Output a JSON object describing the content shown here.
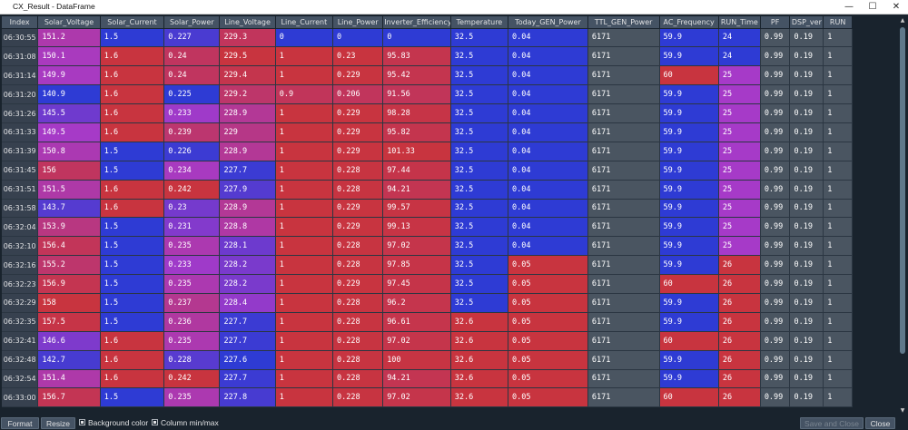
{
  "window": {
    "title": "CX_Result - DataFrame",
    "min_icon": "minimize-icon",
    "max_icon": "maximize-icon",
    "close_icon": "close-icon"
  },
  "columns": [
    "Index",
    "Solar_Voltage",
    "Solar_Current",
    "Solar_Power",
    "Line_Voltage",
    "Line_Current",
    "Line_Power",
    "Inverter_Efficiency",
    "Temperature",
    "Today_GEN_Power",
    "TTL_GEN_Power",
    "AC_Frequency",
    "RUN_Time",
    "PF",
    "DSP_ver",
    "RUN"
  ],
  "rows": [
    [
      "06:30:55",
      "151.2",
      "1.5",
      "0.227",
      "229.3",
      "0",
      "0",
      "0",
      "32.5",
      "0.04",
      "6171",
      "59.9",
      "24",
      "0.99",
      "0.19",
      "1"
    ],
    [
      "06:31:08",
      "150.1",
      "1.6",
      "0.24",
      "229.5",
      "1",
      "0.23",
      "95.83",
      "32.5",
      "0.04",
      "6171",
      "59.9",
      "24",
      "0.99",
      "0.19",
      "1"
    ],
    [
      "06:31:14",
      "149.9",
      "1.6",
      "0.24",
      "229.4",
      "1",
      "0.229",
      "95.42",
      "32.5",
      "0.04",
      "6171",
      "60",
      "25",
      "0.99",
      "0.19",
      "1"
    ],
    [
      "06:31:20",
      "140.9",
      "1.6",
      "0.225",
      "229.2",
      "0.9",
      "0.206",
      "91.56",
      "32.5",
      "0.04",
      "6171",
      "59.9",
      "25",
      "0.99",
      "0.19",
      "1"
    ],
    [
      "06:31:26",
      "145.5",
      "1.6",
      "0.233",
      "228.9",
      "1",
      "0.229",
      "98.28",
      "32.5",
      "0.04",
      "6171",
      "59.9",
      "25",
      "0.99",
      "0.19",
      "1"
    ],
    [
      "06:31:33",
      "149.5",
      "1.6",
      "0.239",
      "229",
      "1",
      "0.229",
      "95.82",
      "32.5",
      "0.04",
      "6171",
      "59.9",
      "25",
      "0.99",
      "0.19",
      "1"
    ],
    [
      "06:31:39",
      "150.8",
      "1.5",
      "0.226",
      "228.9",
      "1",
      "0.229",
      "101.33",
      "32.5",
      "0.04",
      "6171",
      "59.9",
      "25",
      "0.99",
      "0.19",
      "1"
    ],
    [
      "06:31:45",
      "156",
      "1.5",
      "0.234",
      "227.7",
      "1",
      "0.228",
      "97.44",
      "32.5",
      "0.04",
      "6171",
      "59.9",
      "25",
      "0.99",
      "0.19",
      "1"
    ],
    [
      "06:31:51",
      "151.5",
      "1.6",
      "0.242",
      "227.9",
      "1",
      "0.228",
      "94.21",
      "32.5",
      "0.04",
      "6171",
      "59.9",
      "25",
      "0.99",
      "0.19",
      "1"
    ],
    [
      "06:31:58",
      "143.7",
      "1.6",
      "0.23",
      "228.9",
      "1",
      "0.229",
      "99.57",
      "32.5",
      "0.04",
      "6171",
      "59.9",
      "25",
      "0.99",
      "0.19",
      "1"
    ],
    [
      "06:32:04",
      "153.9",
      "1.5",
      "0.231",
      "228.8",
      "1",
      "0.229",
      "99.13",
      "32.5",
      "0.04",
      "6171",
      "59.9",
      "25",
      "0.99",
      "0.19",
      "1"
    ],
    [
      "06:32:10",
      "156.4",
      "1.5",
      "0.235",
      "228.1",
      "1",
      "0.228",
      "97.02",
      "32.5",
      "0.04",
      "6171",
      "59.9",
      "25",
      "0.99",
      "0.19",
      "1"
    ],
    [
      "06:32:16",
      "155.2",
      "1.5",
      "0.233",
      "228.2",
      "1",
      "0.228",
      "97.85",
      "32.5",
      "0.05",
      "6171",
      "59.9",
      "26",
      "0.99",
      "0.19",
      "1"
    ],
    [
      "06:32:23",
      "156.9",
      "1.5",
      "0.235",
      "228.2",
      "1",
      "0.229",
      "97.45",
      "32.5",
      "0.05",
      "6171",
      "60",
      "26",
      "0.99",
      "0.19",
      "1"
    ],
    [
      "06:32:29",
      "158",
      "1.5",
      "0.237",
      "228.4",
      "1",
      "0.228",
      "96.2",
      "32.5",
      "0.05",
      "6171",
      "59.9",
      "26",
      "0.99",
      "0.19",
      "1"
    ],
    [
      "06:32:35",
      "157.5",
      "1.5",
      "0.236",
      "227.7",
      "1",
      "0.228",
      "96.61",
      "32.6",
      "0.05",
      "6171",
      "59.9",
      "26",
      "0.99",
      "0.19",
      "1"
    ],
    [
      "06:32:41",
      "146.6",
      "1.6",
      "0.235",
      "227.7",
      "1",
      "0.228",
      "97.02",
      "32.6",
      "0.05",
      "6171",
      "60",
      "26",
      "0.99",
      "0.19",
      "1"
    ],
    [
      "06:32:48",
      "142.7",
      "1.6",
      "0.228",
      "227.6",
      "1",
      "0.228",
      "100",
      "32.6",
      "0.05",
      "6171",
      "59.9",
      "26",
      "0.99",
      "0.19",
      "1"
    ],
    [
      "06:32:54",
      "151.4",
      "1.6",
      "0.242",
      "227.7",
      "1",
      "0.228",
      "94.21",
      "32.6",
      "0.05",
      "6171",
      "59.9",
      "26",
      "0.99",
      "0.19",
      "1"
    ],
    [
      "06:33:00",
      "156.7",
      "1.5",
      "0.235",
      "227.8",
      "1",
      "0.228",
      "97.02",
      "32.6",
      "0.05",
      "6171",
      "60",
      "26",
      "0.99",
      "0.19",
      "1"
    ]
  ],
  "color_scale": {
    "low": "#2e3bd4",
    "mid": "#a63ac8",
    "high": "#c8343f"
  },
  "bottom_bar": {
    "format_label": "Format",
    "resize_label": "Resize",
    "background_color_label": "Background color",
    "background_color_checked": true,
    "column_minmax_label": "Column min/max",
    "column_minmax_checked": true,
    "save_close_label": "Save and Close",
    "close_label": "Close"
  }
}
